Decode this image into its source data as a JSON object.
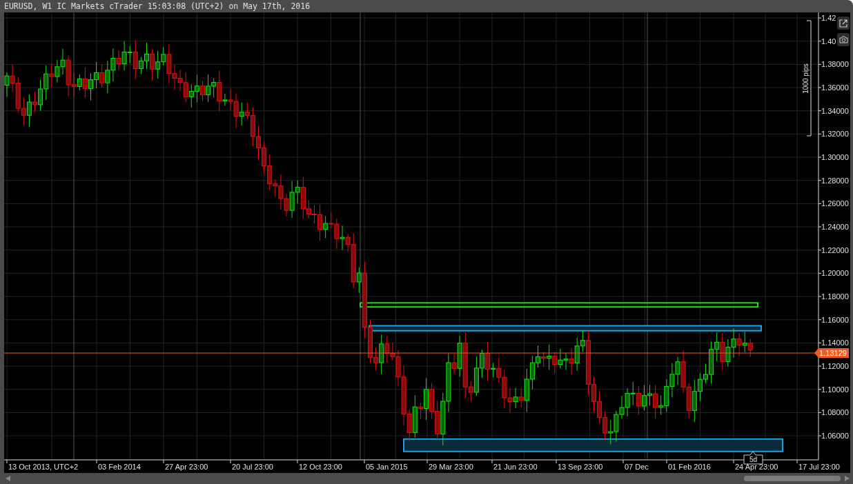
{
  "window": {
    "title": "EURUSD, W1 IC Markets cTrader 15:03:08 (UTC+2) on May 17th, 2016"
  },
  "price_axis": {
    "labels": [
      "1.42",
      "1.40",
      "1.38000",
      "1.36000",
      "1.34000",
      "1.32000",
      "1.30000",
      "1.28000",
      "1.26000",
      "1.24000",
      "1.22000",
      "1.20000",
      "1.18000",
      "1.16000",
      "1.14000",
      "1.12000",
      "1.10000",
      "1.08000",
      "1.06000"
    ]
  },
  "time_axis": {
    "labels": [
      "13 Oct 2013, UTC+2",
      "03 Feb 2014",
      "27 Apr 23:00",
      "20 Jul 23:00",
      "12 Oct 23:00",
      "05 Jan 2015",
      "29 Mar 23:00",
      "21 Jun 23:00",
      "13 Sep 23:00",
      "07 Dec",
      "01 Feb 2016",
      "24 Apr 23:00",
      "17 Jul 23:00"
    ]
  },
  "current_price": "1.13129",
  "ruler": {
    "label": "1000 pips"
  },
  "period_marker": "5d",
  "zones": [
    {
      "color": "#22dd22"
    },
    {
      "color": "#1aa3d9"
    },
    {
      "color": "#1aa3d9"
    }
  ]
}
